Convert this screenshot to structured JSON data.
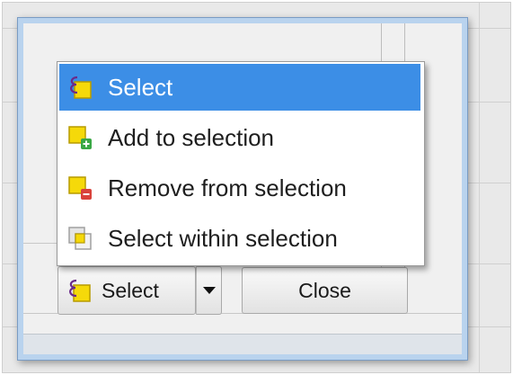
{
  "menu": {
    "items": [
      {
        "label": "Select",
        "icon": "select-icon",
        "active": true
      },
      {
        "label": "Add to selection",
        "icon": "add-selection-icon",
        "active": false
      },
      {
        "label": "Remove from selection",
        "icon": "remove-selection-icon",
        "active": false
      },
      {
        "label": "Select within selection",
        "icon": "select-within-icon",
        "active": false
      }
    ]
  },
  "buttons": {
    "select_label": "Select",
    "close_label": "Close"
  },
  "colors": {
    "highlight": "#3c8ee6",
    "selection_yellow": "#f5d90a",
    "add_green": "#3aa845",
    "remove_red": "#d9423a"
  }
}
